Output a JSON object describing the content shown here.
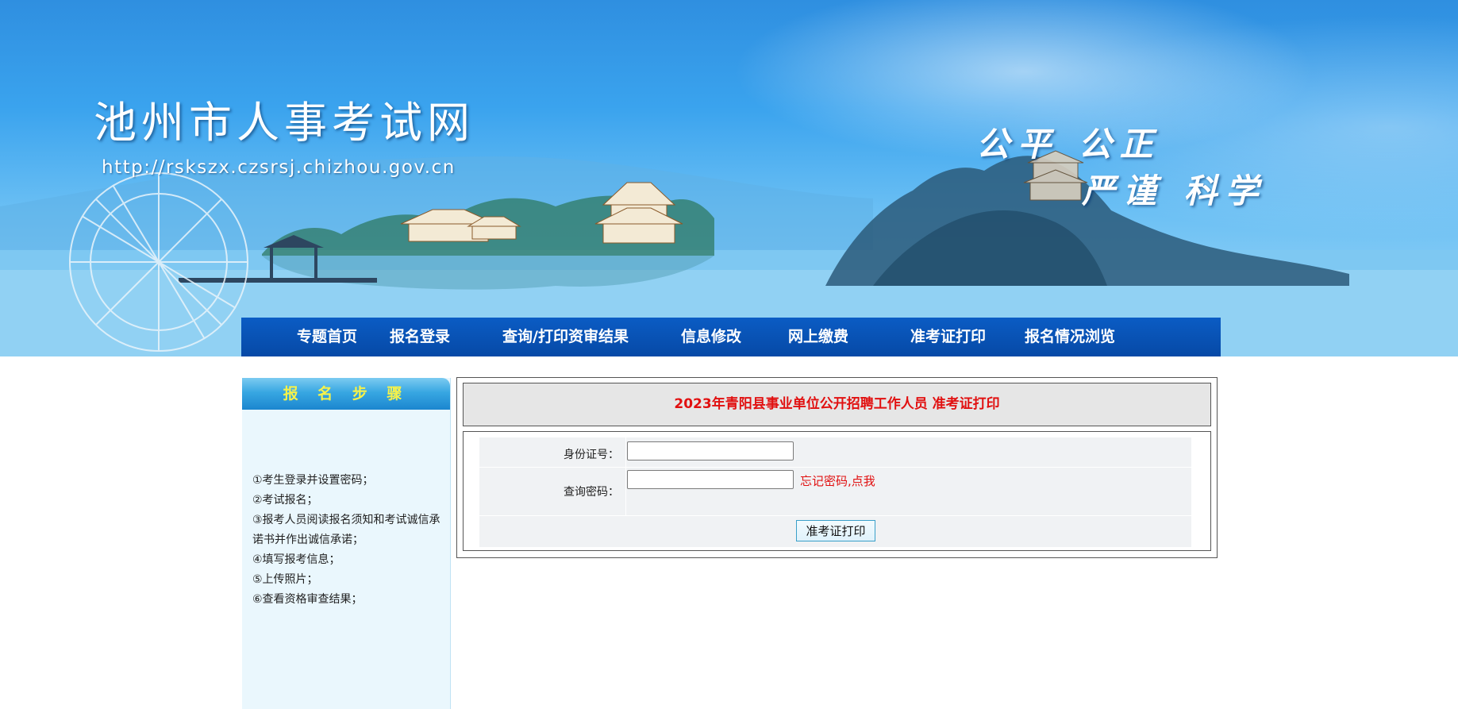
{
  "header": {
    "site_title": "池州市人事考试网",
    "site_url": "http://rskszx.czsrsj.chizhou.gov.cn",
    "slogan_line1": "公平 公正",
    "slogan_line2": "严谨 科学"
  },
  "nav": {
    "items": [
      "专题首页",
      "报名登录",
      "查询/打印资审结果",
      "信息修改",
      "网上缴费",
      "准考证打印",
      "报名情况浏览"
    ]
  },
  "sidebar": {
    "title": "报 名 步 骤",
    "steps": [
      "①考生登录并设置密码；",
      "②考试报名；",
      "③报考人员阅读报名须知和考试诚信承诺书并作出诚信承诺；",
      "④填写报考信息；",
      "⑤上传照片；",
      "⑥查看资格审查结果；"
    ]
  },
  "main": {
    "title": "2023年青阳县事业单位公开招聘工作人员 准考证打印",
    "id_label": "身份证号：",
    "id_value": "",
    "password_label": "查询密码：",
    "password_value": "",
    "forgot_link": "忘记密码,点我",
    "submit_label": "准考证打印"
  },
  "colors": {
    "nav_bg": "#0649a6",
    "title_red": "#e11010",
    "sidebar_title": "#f6f24a",
    "sidebar_bg": "#eaf7fd"
  }
}
